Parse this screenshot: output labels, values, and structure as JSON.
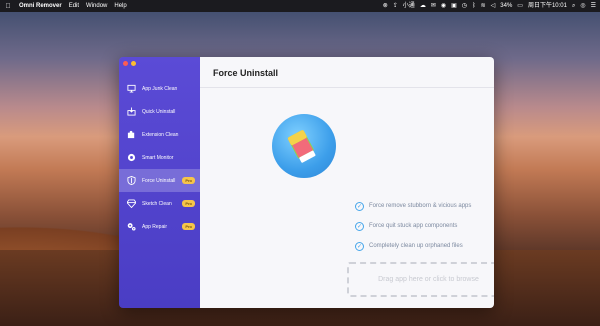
{
  "menubar": {
    "app_name": "Omni Remover",
    "menus": [
      "Edit",
      "Window",
      "Help"
    ],
    "battery": "34%",
    "clock": "周日下午10:01",
    "wechat_label": "小通"
  },
  "sidebar": {
    "items": [
      {
        "label": "App Junk Clean",
        "icon": "monitor-icon",
        "pro": ""
      },
      {
        "label": "Quick Uninstall",
        "icon": "download-box-icon",
        "pro": ""
      },
      {
        "label": "Extension Clean",
        "icon": "puzzle-icon",
        "pro": ""
      },
      {
        "label": "Smart Monitor",
        "icon": "radar-icon",
        "pro": ""
      },
      {
        "label": "Force Uninstall",
        "icon": "shield-icon",
        "pro": "Pro"
      },
      {
        "label": "Sketch Clean",
        "icon": "diamond-icon",
        "pro": "Pro"
      },
      {
        "label": "App Repair",
        "icon": "gears-icon",
        "pro": "Pro"
      }
    ],
    "active_index": 4
  },
  "main": {
    "title": "Force Uninstall",
    "features": [
      "Force remove stubborn & vicious apps",
      "Force quit stuck app components",
      "Completely clean up orphaned files"
    ],
    "dropzone_label": "Drag app here or click to browse"
  },
  "colors": {
    "sidebar": "#5b4bd6",
    "accent": "#47a6ea",
    "pro_badge": "#f6c549"
  }
}
